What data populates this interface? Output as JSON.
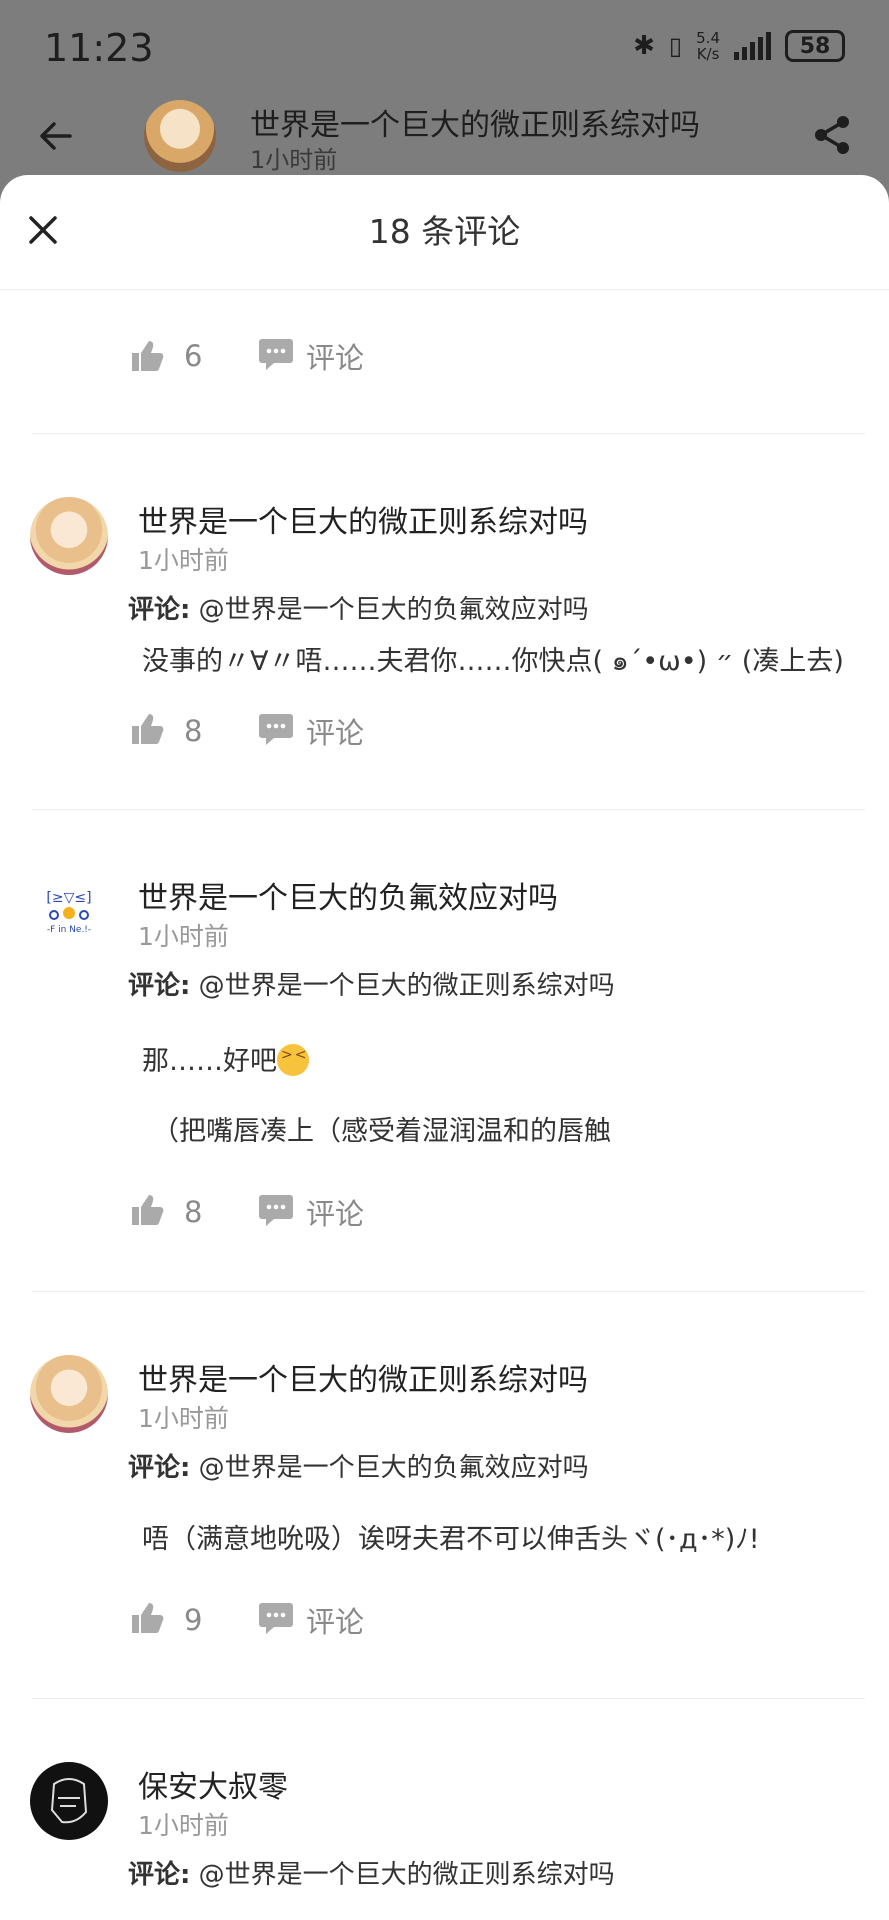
{
  "status_bar": {
    "time": "11:23",
    "speed": "5.4\nK/s",
    "battery": "58"
  },
  "header": {
    "title": "世界是一个巨大的微正则系综对吗",
    "time": "1小时前"
  },
  "sheet": {
    "title": "18 条评论",
    "top_actions": {
      "likes": "6",
      "reply_label": "评论"
    }
  },
  "comments": [
    {
      "name": "世界是一个巨大的微正则系综对吗",
      "time": "1小时前",
      "reply_prefix": "评论:",
      "reply_to": "@世界是一个巨大的负氟效应对吗",
      "lines": [
        "没事的〃∀〃唔……夫君你……你快点( ๑´•ω•) ״ (凑上去)"
      ],
      "likes": "8",
      "reply_label": "评论"
    },
    {
      "name": "世界是一个巨大的负氟效应对吗",
      "time": "1小时前",
      "reply_prefix": "评论:",
      "reply_to": "@世界是一个巨大的微正则系综对吗",
      "lines": [
        "那……好吧",
        "（把嘴唇凑上（感受着湿润温和的唇触"
      ],
      "likes": "8",
      "reply_label": "评论"
    },
    {
      "name": "世界是一个巨大的微正则系综对吗",
      "time": "1小时前",
      "reply_prefix": "评论:",
      "reply_to": "@世界是一个巨大的负氟效应对吗",
      "lines": [
        "唔（满意地吮吸）诶呀夫君不可以伸舌头ヾ(･д･*)ﾉ!"
      ],
      "likes": "9",
      "reply_label": "评论"
    },
    {
      "name": "保安大叔零",
      "time": "1小时前",
      "reply_prefix": "评论:",
      "reply_to": "@世界是一个巨大的微正则系综对吗"
    }
  ],
  "icons": {
    "back": "back-arrow-icon",
    "share": "share-icon",
    "close": "close-icon",
    "like": "thumbs-up-icon",
    "comment": "comment-bubble-icon"
  }
}
